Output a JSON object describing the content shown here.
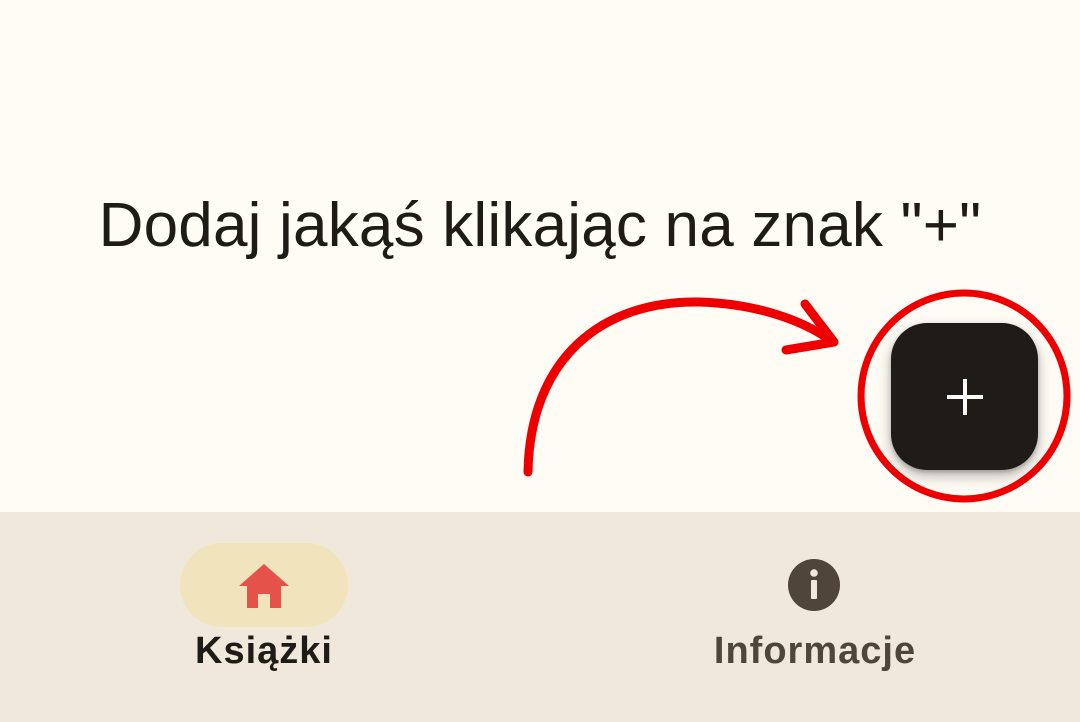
{
  "empty_state": {
    "hint": "Dodaj jakąś klikając na znak \"+\""
  },
  "fab": {
    "icon": "plus-icon"
  },
  "bottom_nav": {
    "items": [
      {
        "label": "Książki",
        "icon": "home-icon",
        "selected": true
      },
      {
        "label": "Informacje",
        "icon": "info-icon",
        "selected": false
      }
    ]
  },
  "colors": {
    "background": "#fffbf5",
    "text": "#1f1b16",
    "fab": "#1f1b16",
    "nav_background": "#f0e8db",
    "active_pill": "#f1e3bc",
    "active_icon": "#e5524a",
    "inactive": "#4f4539",
    "annotation": "#ee0000"
  }
}
